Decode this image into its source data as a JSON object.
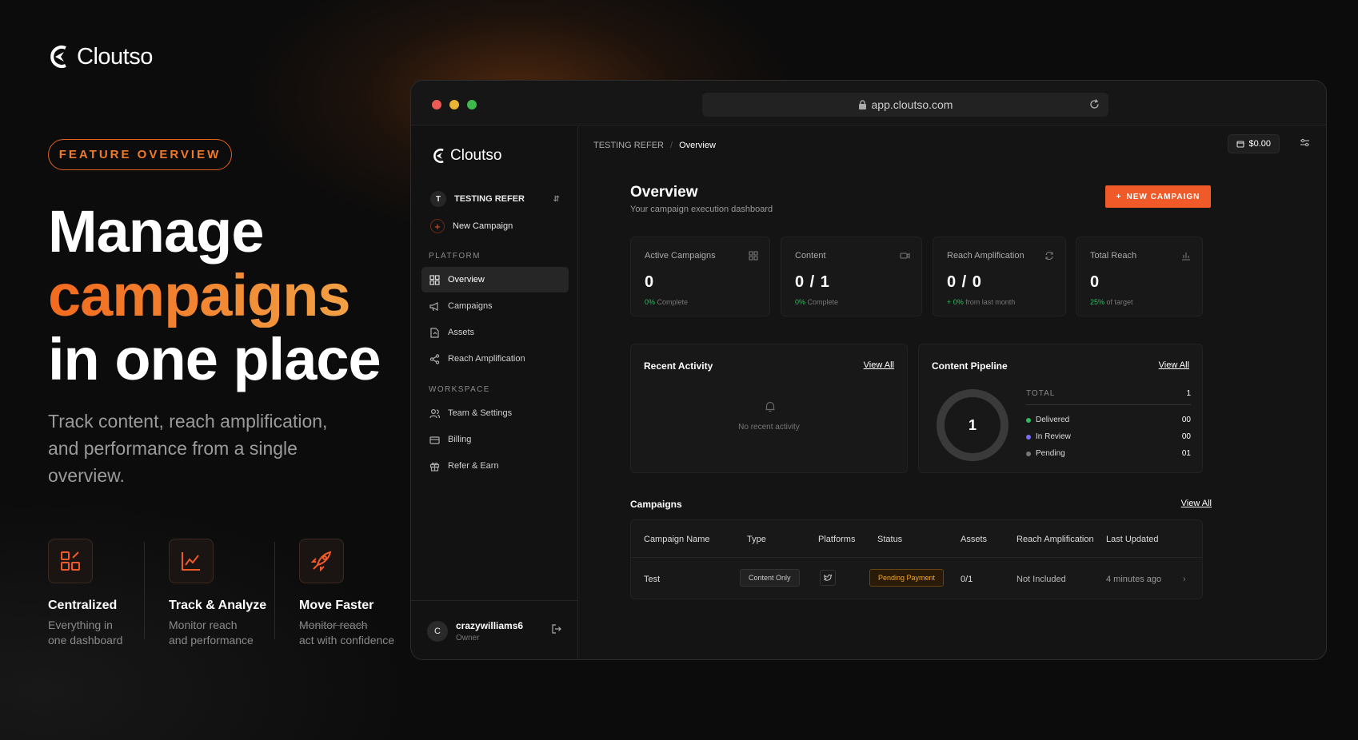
{
  "brand": {
    "name": "Cloutso"
  },
  "hero": {
    "pill": "FEATURE OVERVIEW",
    "line1": "Manage",
    "line2": "campaigns",
    "line3": "in one place",
    "subtitle": "Track content, reach amplification, and performance from a single overview."
  },
  "features": [
    {
      "icon": "grid-icon",
      "title": "Centralized",
      "desc1": "Everything in",
      "desc2": "one dashboard"
    },
    {
      "icon": "chart-line-icon",
      "title": "Track & Analyze",
      "desc1": "Monitor reach",
      "desc2": "and performance"
    },
    {
      "icon": "rocket-icon",
      "title": "Move Faster",
      "desc1": "Monitor reach",
      "desc2": "act with confidence"
    }
  ],
  "colors": {
    "accent": "#f05a28",
    "accent_light": "#f2a145",
    "success": "#2dbb5d",
    "review": "#7b6cf6",
    "pending": "#777777",
    "status_pending": "#f5a623"
  },
  "browser": {
    "url": "app.cloutso.com"
  },
  "sidebar": {
    "logo": "Cloutso",
    "workspace": {
      "initial": "T",
      "name": "TESTING REFER"
    },
    "new_campaign": "New Campaign",
    "platform_label": "PLATFORM",
    "platform_items": [
      {
        "icon": "grid-icon",
        "label": "Overview",
        "active": true
      },
      {
        "icon": "megaphone-icon",
        "label": "Campaigns"
      },
      {
        "icon": "file-icon",
        "label": "Assets"
      },
      {
        "icon": "share-icon",
        "label": "Reach Amplification"
      }
    ],
    "workspace_label": "WORKSPACE",
    "workspace_items": [
      {
        "icon": "users-icon",
        "label": "Team & Settings"
      },
      {
        "icon": "card-icon",
        "label": "Billing"
      },
      {
        "icon": "gift-icon",
        "label": "Refer & Earn"
      }
    ],
    "user": {
      "initial": "C",
      "name": "crazywilliams6",
      "role": "Owner"
    }
  },
  "header": {
    "breadcrumb": [
      "TESTING REFER",
      "/",
      "Overview"
    ],
    "balance": "$0.00"
  },
  "overview": {
    "title": "Overview",
    "subtitle": "Your campaign execution dashboard",
    "new_campaign_button": "NEW CAMPAIGN"
  },
  "stats": [
    {
      "label": "Active Campaigns",
      "value": "0",
      "foot_val": "0%",
      "foot": "Complete",
      "icon": "grid-icon"
    },
    {
      "label": "Content",
      "value": "0 / 1",
      "foot_val": "0%",
      "foot": "Complete",
      "icon": "video-icon"
    },
    {
      "label": "Reach Amplification",
      "value": "0 / 0",
      "foot_val": "+ 0%",
      "foot": "from last month",
      "icon": "refresh-icon"
    },
    {
      "label": "Total Reach",
      "value": "0",
      "foot_val": "25%",
      "foot": "of target",
      "icon": "bar-chart-icon"
    }
  ],
  "recent_activity": {
    "title": "Recent Activity",
    "view_all": "View All",
    "empty": "No recent activity"
  },
  "pipeline": {
    "title": "Content Pipeline",
    "view_all": "View All",
    "center": "1",
    "total_label": "TOTAL",
    "total": "1",
    "rows": [
      {
        "label": "Delivered",
        "value": "00",
        "color": "#2dbb5d"
      },
      {
        "label": "In Review",
        "value": "00",
        "color": "#7b6cf6"
      },
      {
        "label": "Pending",
        "value": "01",
        "color": "#777777"
      }
    ]
  },
  "campaigns": {
    "title": "Campaigns",
    "view_all": "View All",
    "columns": [
      "Campaign Name",
      "Type",
      "Platforms",
      "Status",
      "Assets",
      "Reach Amplification",
      "Last Updated"
    ],
    "rows": [
      {
        "name": "Test",
        "type": "Content Only",
        "platform_icon": "twitter-icon",
        "status": "Pending Payment",
        "assets": "0/1",
        "reach": "Not Included",
        "updated": "4 minutes ago"
      }
    ]
  }
}
